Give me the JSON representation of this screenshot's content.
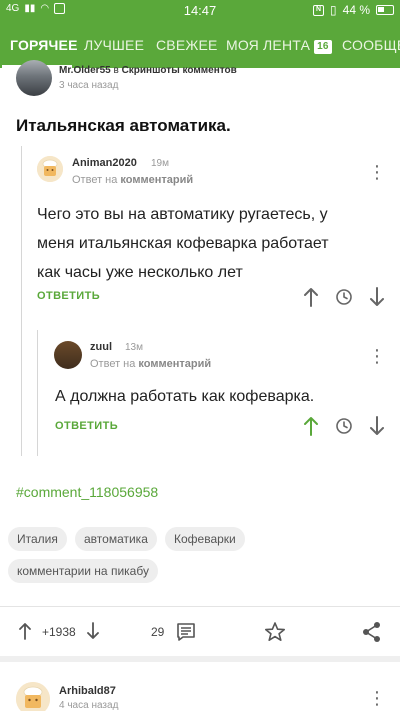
{
  "status_bar": {
    "network": "4G",
    "time": "14:47",
    "battery": "44 %"
  },
  "tabs": [
    {
      "label": "ГОРЯЧЕЕ",
      "active": true
    },
    {
      "label": "ЛУЧШЕЕ",
      "active": false
    },
    {
      "label": "СВЕЖЕЕ",
      "active": false
    },
    {
      "label": "МОЯ ЛЕНТА",
      "active": false,
      "badge": "16"
    },
    {
      "label": "СООБЩЕСТВА",
      "active": false
    }
  ],
  "post": {
    "author": "Mr.Older55",
    "in_label": "в",
    "community": "Скриншоты комментов",
    "time": "3 часа назад",
    "title": "Итальянская автоматика."
  },
  "comments": [
    {
      "author": "Animan2020",
      "time": "19м",
      "reply_prefix": "Ответ на",
      "reply_target": "комментарий",
      "text_lines": [
        "Чего это вы на автоматику ругаетесь, у",
        "меня итальянская кофеварка работает",
        "как часы уже несколько лет"
      ],
      "reply_label": "ОТВЕТИТЬ"
    },
    {
      "author": "zuul",
      "time": "13м",
      "reply_prefix": "Ответ на",
      "reply_target": "комментарий",
      "text_lines": [
        "А должна работать как кофеварка."
      ],
      "reply_label": "ОТВЕТИТЬ",
      "upvoted": true
    }
  ],
  "hashtag": "#comment_118056958",
  "tags": [
    "Италия",
    "автоматика",
    "Кофеварки",
    "комментарии на пикабу"
  ],
  "bottom_bar": {
    "rating": "+1938",
    "comments_count": "29"
  },
  "next_post": {
    "author": "Arhibald87",
    "time": "4 часа назад"
  },
  "colors": {
    "accent": "#5aa83a",
    "text": "#222222",
    "muted": "#999999"
  },
  "icons": {
    "upvote": "arrow-up-icon",
    "downvote": "arrow-down-icon",
    "history": "clock-icon",
    "more": "kebab-menu-icon",
    "comments": "comment-icon",
    "save": "star-icon",
    "share": "share-icon"
  }
}
